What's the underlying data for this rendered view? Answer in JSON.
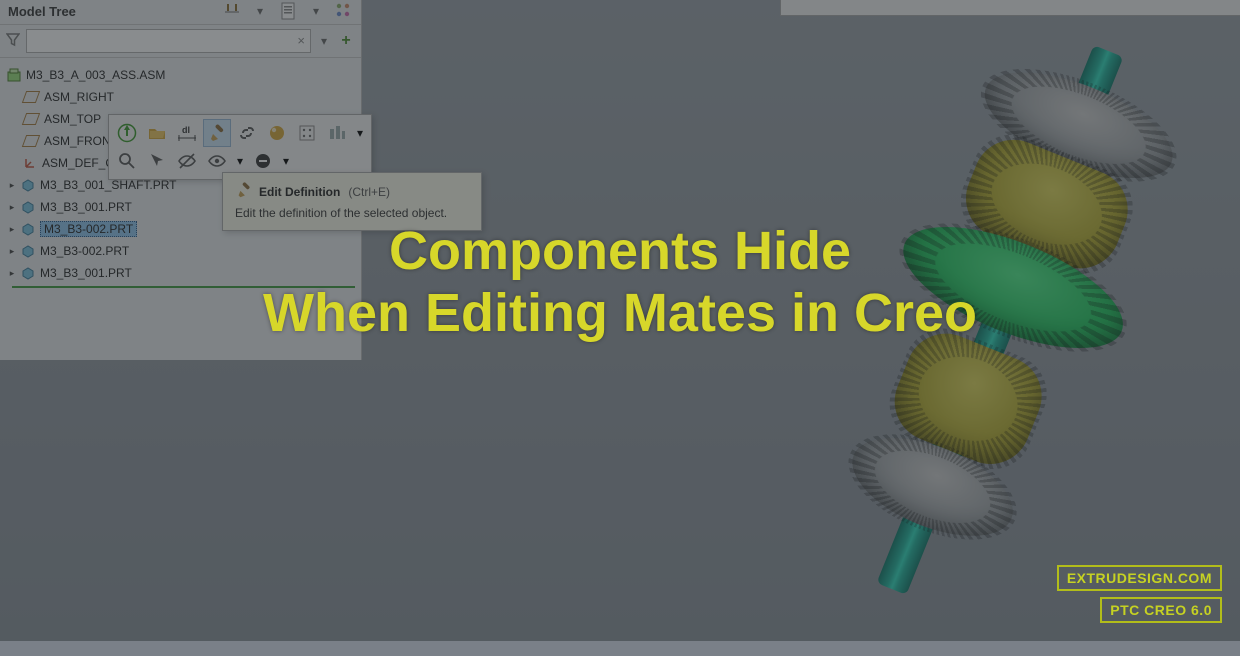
{
  "panel": {
    "title": "Model Tree",
    "search_placeholder": ""
  },
  "tree": {
    "root": "M3_B3_A_003_ASS.ASM",
    "items": [
      {
        "label": "ASM_RIGHT",
        "type": "datum"
      },
      {
        "label": "ASM_TOP",
        "type": "datum"
      },
      {
        "label": "ASM_FRONT",
        "type": "datum"
      },
      {
        "label": "ASM_DEF_CSYS",
        "type": "csys"
      },
      {
        "label": "M3_B3_001_SHAFT.PRT",
        "type": "part"
      },
      {
        "label": "M3_B3_001.PRT",
        "type": "part"
      },
      {
        "label": "M3_B3-002.PRT",
        "type": "part",
        "selected": true
      },
      {
        "label": "M3_B3-002.PRT",
        "type": "part"
      },
      {
        "label": "M3_B3_001.PRT",
        "type": "part"
      }
    ]
  },
  "tooltip": {
    "title": "Edit Definition",
    "shortcut": "(Ctrl+E)",
    "desc": "Edit the definition of the selected object."
  },
  "overlay": {
    "line1": "Components Hide",
    "line2": "When Editing Mates in Creo"
  },
  "badges": {
    "site": "EXTRUDESIGN.COM",
    "product": "PTC CREO 6.0"
  },
  "icons": {
    "settings": "⚙",
    "show": "☰",
    "filter": "▽",
    "clear": "×",
    "chevron": "▾",
    "plus": "+",
    "expand": "▸"
  }
}
